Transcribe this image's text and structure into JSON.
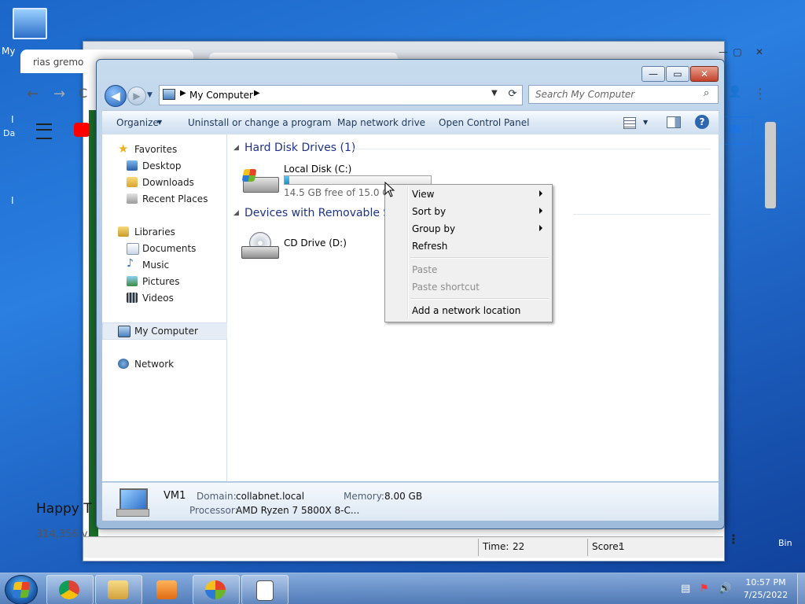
{
  "desktop": {
    "icon_label": "My",
    "side_text_1": "I",
    "side_text_2": "Da",
    "side_text_3": "I",
    "bin_label": "Bin"
  },
  "chrome": {
    "tab_title": "rias gremo",
    "back": "←",
    "forward": "→",
    "reload": "C",
    "avatar": "👤",
    "menu": "⋮",
    "sign_in": "IN",
    "video_title": "Happy T",
    "video_views": "314,356 v",
    "more": "⋮",
    "min": "—",
    "max": "▢",
    "close": "✕"
  },
  "solitaire": {
    "time_label": "Time:",
    "time_value": "22",
    "score_label": "Score:",
    "score_value": "1"
  },
  "explorer": {
    "btn_min": "—",
    "btn_max": "▭",
    "btn_close": "✕",
    "nav_back": "◀",
    "nav_forward": "▶",
    "nav_drop": "▼",
    "address_chev": "▶",
    "address_location": "My Computer",
    "address_drop": "▼",
    "refresh": "⟳",
    "search_placeholder": "Search My Computer",
    "search_icon": "⌕",
    "commands": {
      "organize": "Organize",
      "organize_arrow": "▼",
      "uninstall": "Uninstall or change a program",
      "map_drive": "Map network drive",
      "control_panel": "Open Control Panel",
      "view_arrow": "▼",
      "help": "?"
    },
    "nav": {
      "favorites": "Favorites",
      "desktop": "Desktop",
      "downloads": "Downloads",
      "recent": "Recent Places",
      "libraries": "Libraries",
      "documents": "Documents",
      "music": "Music",
      "pictures": "Pictures",
      "videos": "Videos",
      "my_computer": "My Computer",
      "network": "Network"
    },
    "content": {
      "group_tri": "◢",
      "hard_disk_header": "Hard Disk Drives (1)",
      "removable_header": "Devices with Removable St",
      "local_disk": {
        "name": "Local Disk (C:)",
        "free": "14.5 GB free of 15.0 GB",
        "used_fraction": 0.033
      },
      "cd_drive": {
        "name": "CD Drive (D:)"
      }
    },
    "details": {
      "name": "VM1",
      "domain_label": "Domain:",
      "domain_value": "collabnet.local",
      "memory_label": "Memory:",
      "memory_value": "8.00 GB",
      "processor_label": "Processor:",
      "processor_value": "AMD Ryzen 7 5800X 8-C..."
    }
  },
  "context_menu": {
    "view": "View",
    "sort_by": "Sort by",
    "group_by": "Group by",
    "refresh": "Refresh",
    "paste": "Paste",
    "paste_shortcut": "Paste shortcut",
    "add_network": "Add a network location"
  },
  "taskbar": {
    "clock_time": "10:57 PM",
    "clock_date": "7/25/2022"
  }
}
